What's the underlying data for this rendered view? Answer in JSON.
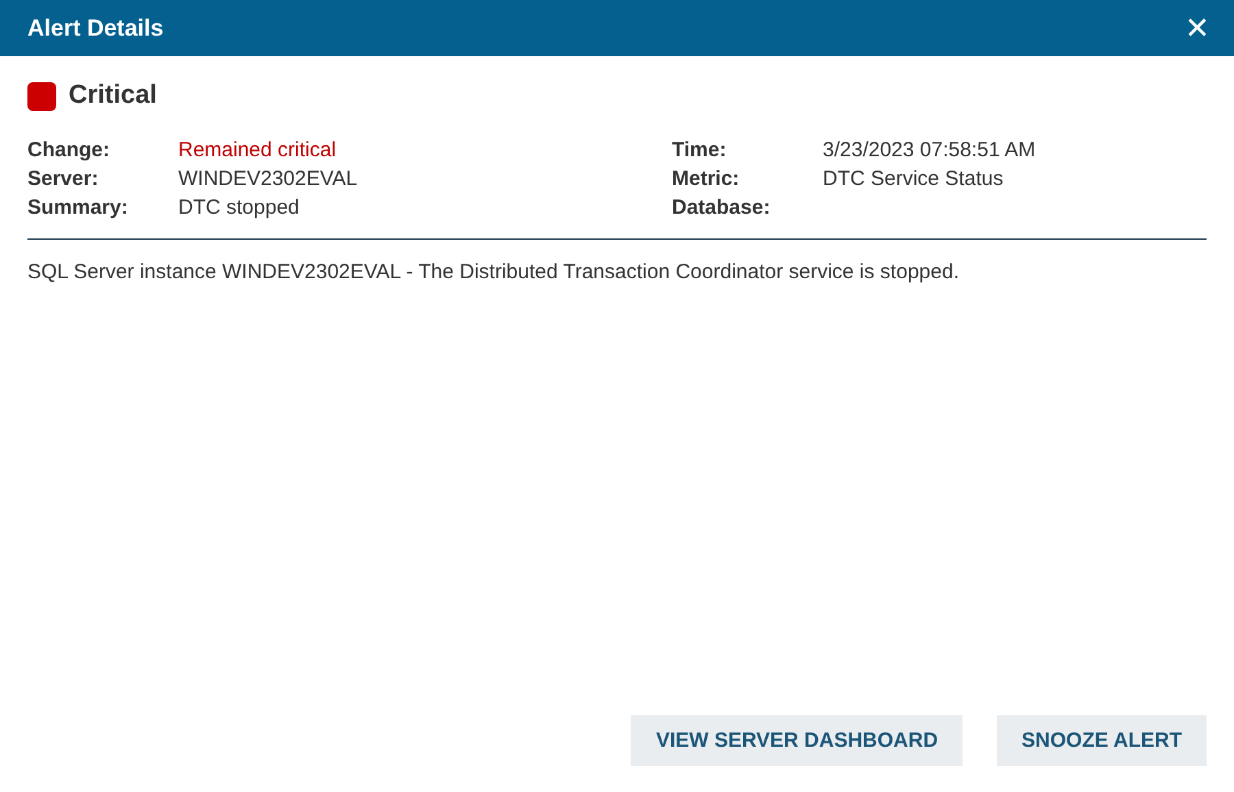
{
  "window": {
    "title": "Alert Details",
    "close": "✕"
  },
  "severity": {
    "label": "Critical",
    "kind": "critical"
  },
  "fields_left": [
    {
      "label": "Change:",
      "value": "Remained critical",
      "highlighted": true
    },
    {
      "label": "Server:",
      "value": "WINDEV2302EVAL",
      "highlighted": false
    },
    {
      "label": "Summary:",
      "value": "DTC stopped",
      "highlighted": false
    }
  ],
  "fields_right": [
    {
      "label": "Time:",
      "value": "3/23/2023 07:58:51 AM",
      "highlighted": false
    },
    {
      "label": "Metric:",
      "value": "DTC Service Status",
      "highlighted": false
    },
    {
      "label": "Database:"
    }
  ],
  "description": "SQL Server instance WINDEV2302EVAL - The Distributed Transaction Coordinator service is stopped.",
  "buttons": [
    "VIEW SERVER DASHBOARD",
    "SNOOZE ALERT"
  ]
}
